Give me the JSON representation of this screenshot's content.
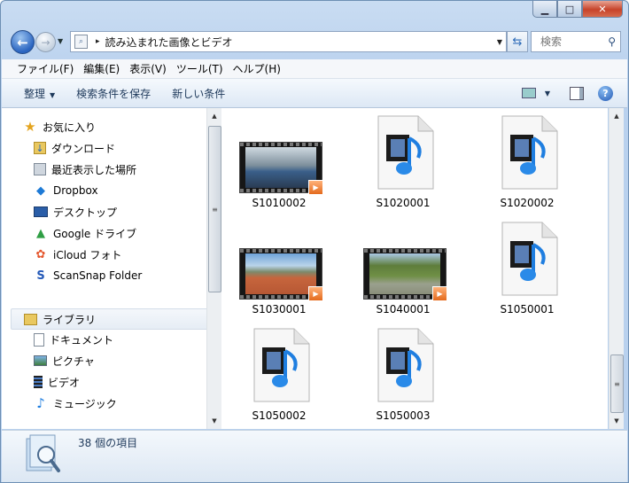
{
  "window": {
    "caption_buttons": {
      "minimize": "▁",
      "maximize": "□",
      "close": "✕"
    }
  },
  "navigation": {
    "back_icon": "←",
    "forward_icon": "→",
    "path_separator": "▸",
    "path": "読み込まれた画像とビデオ",
    "search_placeholder": "検索"
  },
  "menu": {
    "items": [
      "ファイル(F)",
      "編集(E)",
      "表示(V)",
      "ツール(T)",
      "ヘルプ(H)"
    ]
  },
  "commandbar": {
    "organize": "整理",
    "save_search": "検索条件を保存",
    "new_search": "新しい条件",
    "help_glyph": "?"
  },
  "sidebar": {
    "favorites_header": "お気に入り",
    "favorites": [
      {
        "label": "ダウンロード",
        "icon": "download-folder-icon"
      },
      {
        "label": "最近表示した場所",
        "icon": "recent-places-icon"
      },
      {
        "label": "Dropbox",
        "icon": "dropbox-icon"
      },
      {
        "label": "デスクトップ",
        "icon": "desktop-icon"
      },
      {
        "label": "Google ドライブ",
        "icon": "google-drive-icon"
      },
      {
        "label": "iCloud フォト",
        "icon": "icloud-photos-icon"
      },
      {
        "label": "ScanSnap Folder",
        "icon": "scansnap-icon"
      }
    ],
    "libraries_header": "ライブラリ",
    "libraries": [
      {
        "label": "ドキュメント",
        "icon": "documents-icon"
      },
      {
        "label": "ピクチャ",
        "icon": "pictures-icon"
      },
      {
        "label": "ビデオ",
        "icon": "videos-icon"
      },
      {
        "label": "ミュージック",
        "icon": "music-icon"
      }
    ]
  },
  "files": [
    {
      "name": "S1010002",
      "kind": "video-thumbnail",
      "scene": "indoor"
    },
    {
      "name": "S1020001",
      "kind": "media-file"
    },
    {
      "name": "S1020002",
      "kind": "media-file"
    },
    {
      "name": "S1030001",
      "kind": "video-thumbnail",
      "scene": "rooftop"
    },
    {
      "name": "S1040001",
      "kind": "video-thumbnail",
      "scene": "path"
    },
    {
      "name": "S1050001",
      "kind": "media-file"
    },
    {
      "name": "S1050002",
      "kind": "media-file"
    },
    {
      "name": "S1050003",
      "kind": "media-file"
    }
  ],
  "details": {
    "item_count": "38 個の項目"
  },
  "colors": {
    "accent": "#2a64c0",
    "close_button": "#c7432a",
    "play_badge": "#e46a1c"
  }
}
